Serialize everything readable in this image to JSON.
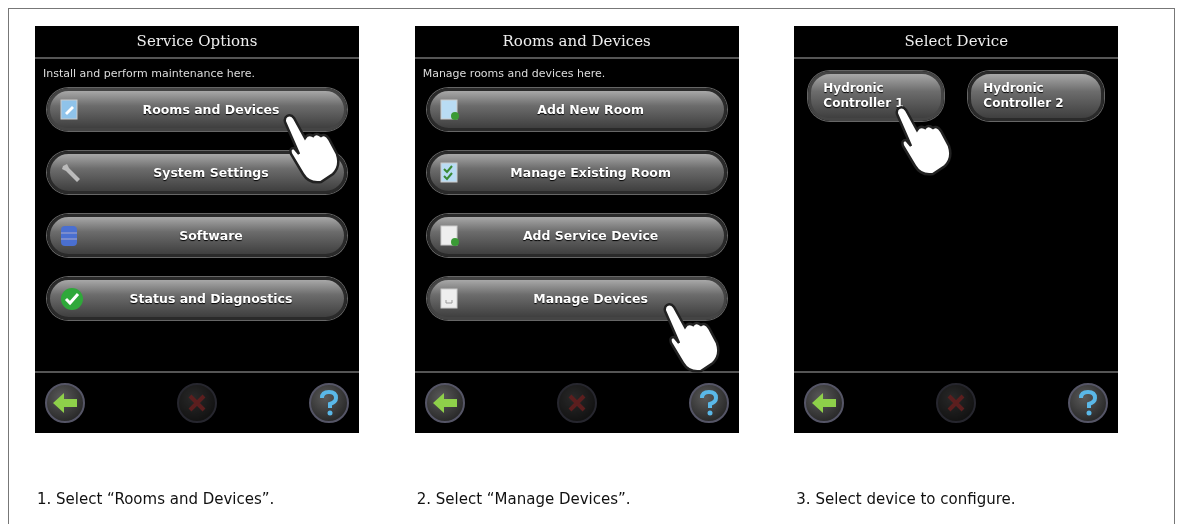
{
  "panels": [
    {
      "screen": {
        "title": "Service Options",
        "subtitle": "Install and perform maintenance here.",
        "kind": "list",
        "buttons": [
          {
            "label": "Rooms and Devices",
            "kind": "document",
            "selected": true
          },
          {
            "label": "System Settings",
            "kind": "wrench",
            "selected": false
          },
          {
            "label": "Software",
            "kind": "database",
            "selected": false
          },
          {
            "label": "Status and Diagnostics",
            "kind": "check",
            "selected": false
          }
        ],
        "nav": [
          {
            "kind": "back",
            "disabled": false
          },
          {
            "kind": "cancel",
            "disabled": true
          },
          {
            "kind": "help",
            "disabled": false
          }
        ]
      },
      "caption": "1. Select “Rooms and Devices”."
    },
    {
      "screen": {
        "title": "Rooms and Devices",
        "subtitle": "Manage rooms and devices here.",
        "kind": "list",
        "buttons": [
          {
            "label": "Add New Room",
            "kind": "add-room",
            "selected": false
          },
          {
            "label": "Manage Existing Room",
            "kind": "checklist",
            "selected": false
          },
          {
            "label": "Add Service Device",
            "kind": "add-device",
            "selected": false
          },
          {
            "label": "Manage Devices",
            "kind": "device",
            "selected": true
          }
        ],
        "nav": [
          {
            "kind": "back",
            "disabled": false
          },
          {
            "kind": "cancel",
            "disabled": true
          },
          {
            "kind": "help",
            "disabled": false
          }
        ]
      },
      "caption": "2. Select “Manage Devices”."
    },
    {
      "screen": {
        "title": "Select Device",
        "kind": "grid",
        "buttons": [
          {
            "label": "Hydronic Controller 1",
            "selected": true
          },
          {
            "label": "Hydronic Controller 2",
            "selected": false
          }
        ],
        "nav": [
          {
            "kind": "back",
            "disabled": false
          },
          {
            "kind": "cancel",
            "disabled": true
          },
          {
            "kind": "help",
            "disabled": false
          }
        ]
      },
      "caption": "3. Select device to configure."
    }
  ]
}
